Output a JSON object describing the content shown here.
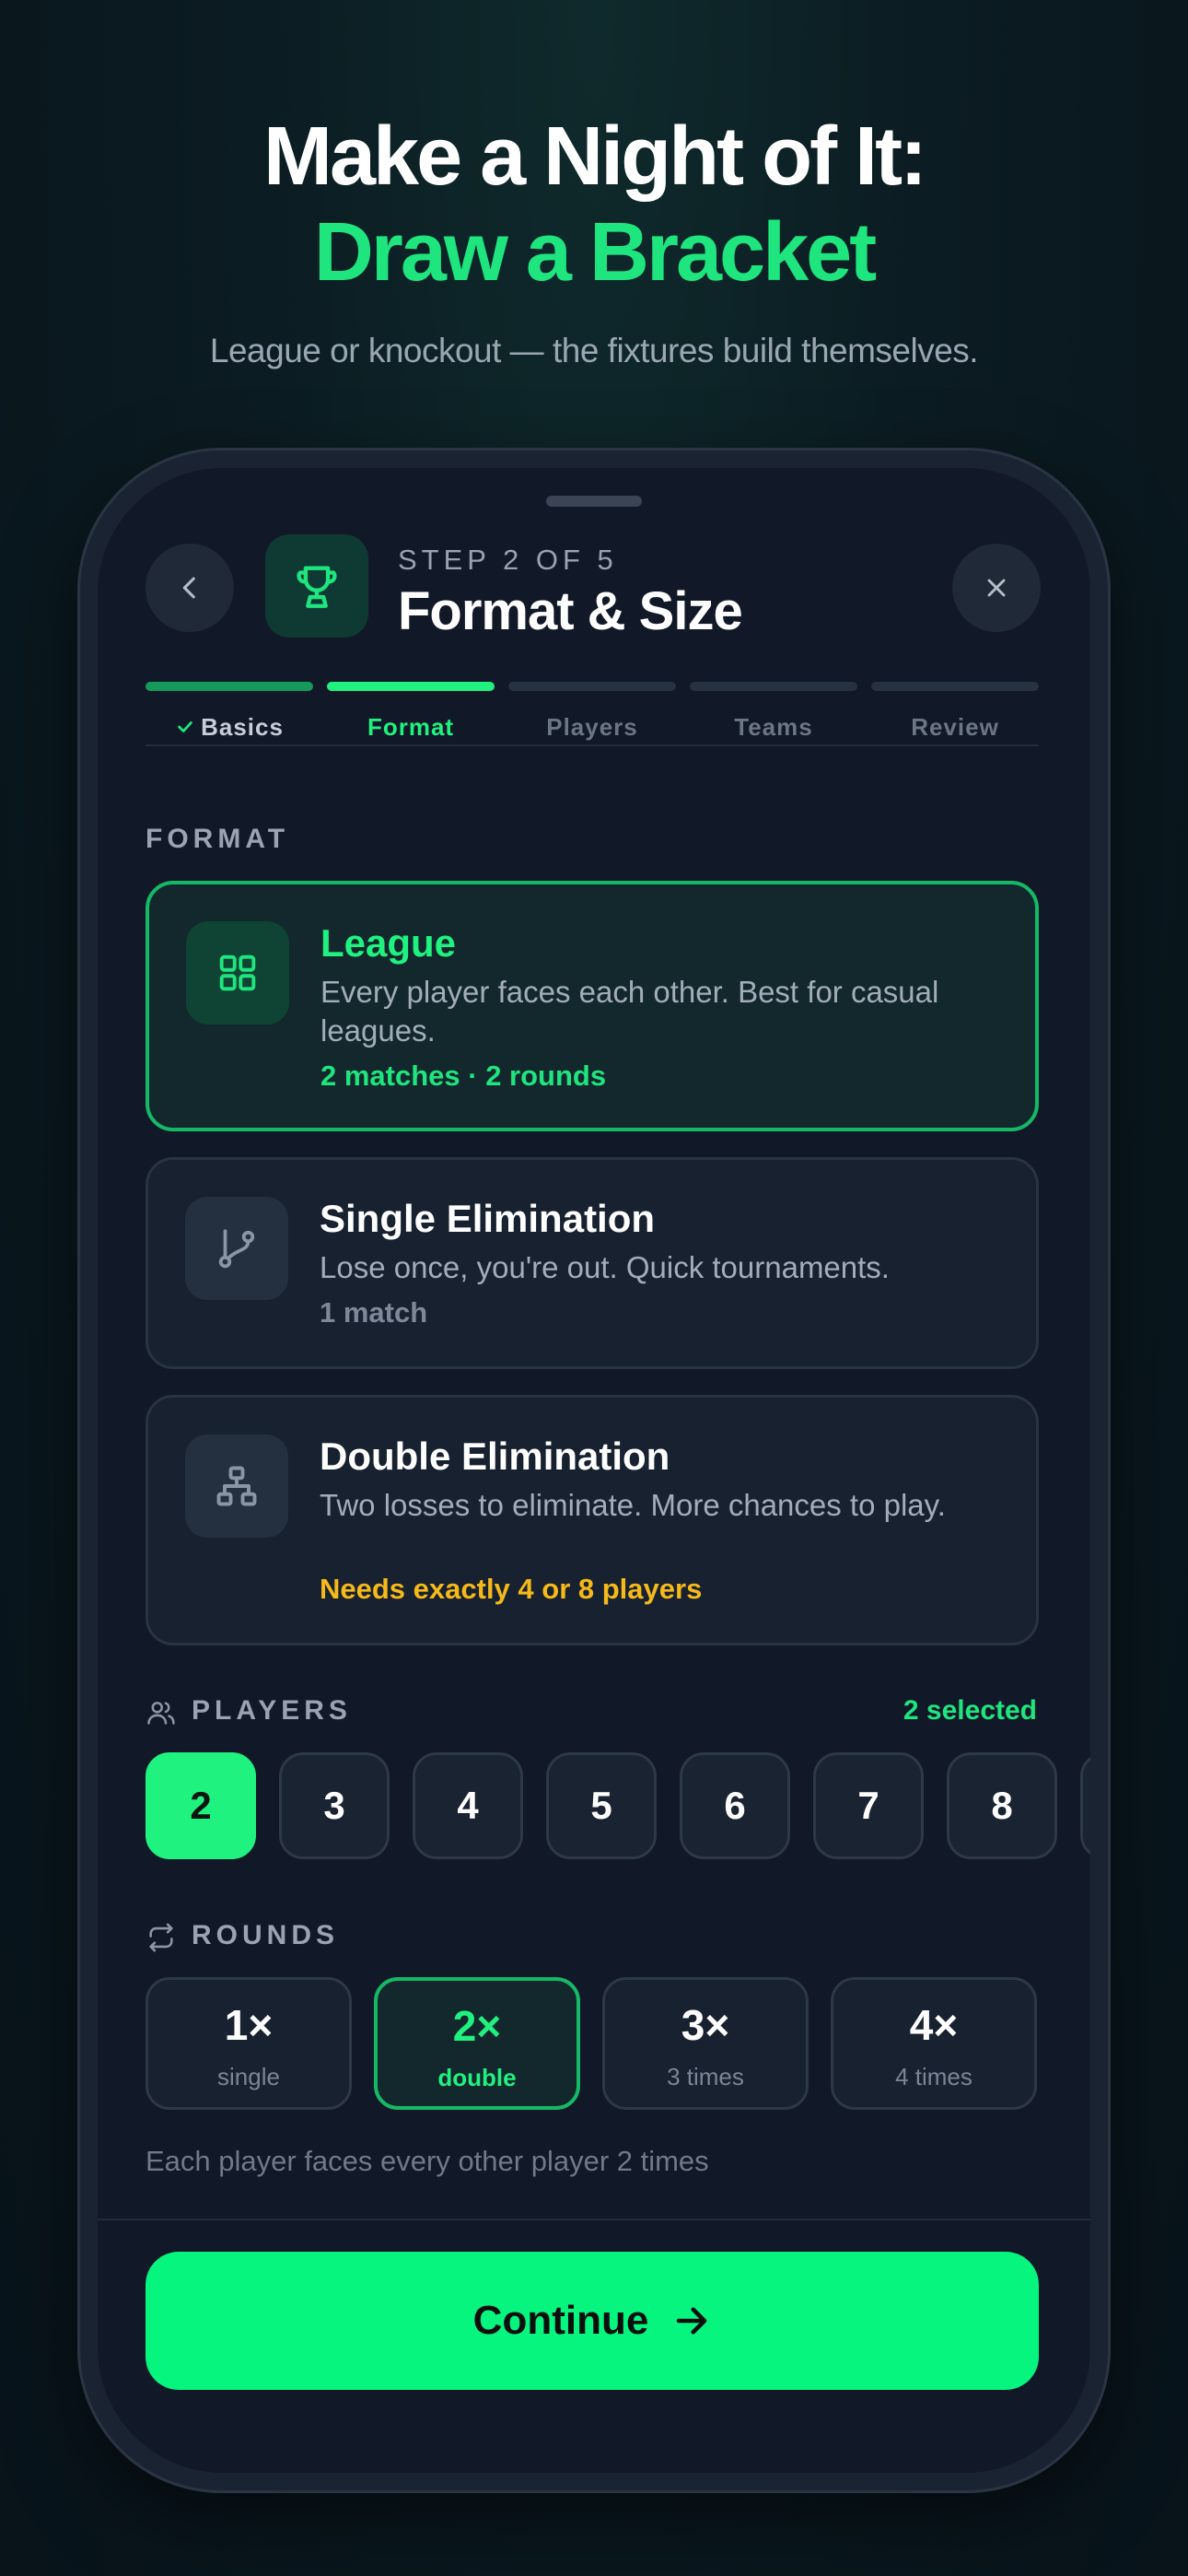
{
  "hero": {
    "title_line1": "Make a Night of It:",
    "title_line2": "Draw a Bracket",
    "subtitle": "League or knockout — the fixtures build themselves."
  },
  "header": {
    "step_label": "STEP 2 OF 5",
    "title": "Format & Size",
    "back_icon": "chevron-left-icon",
    "close_icon": "close-icon",
    "step_icon": "trophy-icon"
  },
  "progress": {
    "steps": [
      {
        "label": "Basics",
        "state": "done"
      },
      {
        "label": "Format",
        "state": "active"
      },
      {
        "label": "Players",
        "state": "upcoming"
      },
      {
        "label": "Teams",
        "state": "upcoming"
      },
      {
        "label": "Review",
        "state": "upcoming"
      }
    ]
  },
  "format": {
    "section_label": "FORMAT",
    "options": [
      {
        "title": "League",
        "description": "Every player faces each other. Best for casual leagues.",
        "meta": "2 matches · 2 rounds",
        "icon": "grid-icon",
        "selected": true
      },
      {
        "title": "Single Elimination",
        "description": "Lose once, you're out. Quick tournaments.",
        "meta": "1 match",
        "icon": "branch-icon",
        "selected": false
      },
      {
        "title": "Double Elimination",
        "description": "Two losses to eliminate. More chances to play.",
        "meta": "Needs exactly 4 or 8 players",
        "icon": "bracket-icon",
        "selected": false
      }
    ]
  },
  "players": {
    "section_label": "PLAYERS",
    "selected_count": "2 selected",
    "options": [
      "2",
      "3",
      "4",
      "5",
      "6",
      "7",
      "8",
      ""
    ],
    "selected": "2"
  },
  "rounds": {
    "section_label": "ROUNDS",
    "options": [
      {
        "value": "1×",
        "caption": "single"
      },
      {
        "value": "2×",
        "caption": "double"
      },
      {
        "value": "3×",
        "caption": "3 times"
      },
      {
        "value": "4×",
        "caption": "4 times"
      }
    ],
    "selected": "2×",
    "note": "Each player faces every other player 2 times"
  },
  "footer": {
    "continue_label": "Continue",
    "continue_icon": "arrow-right-icon"
  },
  "colors": {
    "accent": "#1ff27f",
    "warning": "#f5b91a",
    "background": "#111827"
  }
}
